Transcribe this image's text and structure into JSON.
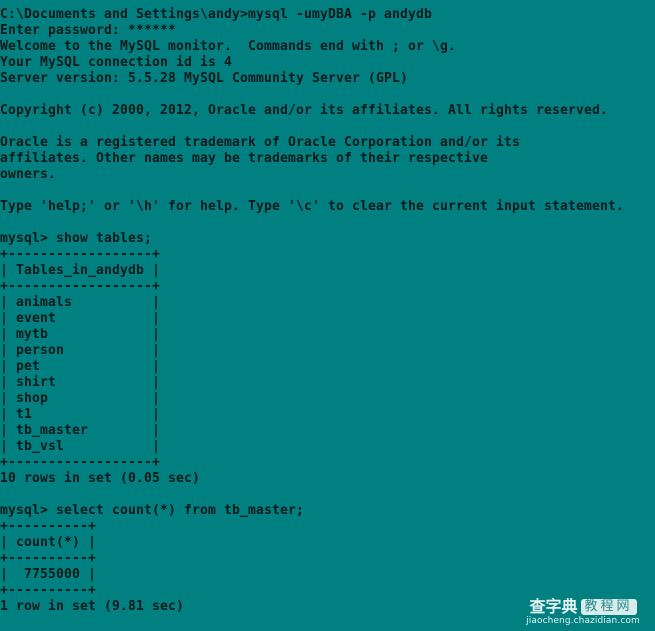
{
  "window": {
    "background_color": "#008080",
    "text_color": "#0c1a1a"
  },
  "console": {
    "lines": [
      "C:\\Documents and Settings\\andy>mysql -umyDBA -p andydb",
      "Enter password: ******",
      "Welcome to the MySQL monitor.  Commands end with ; or \\g.",
      "Your MySQL connection id is 4",
      "Server version: 5.5.28 MySQL Community Server (GPL)",
      "",
      "Copyright (c) 2000, 2012, Oracle and/or its affiliates. All rights reserved.",
      "",
      "Oracle is a registered trademark of Oracle Corporation and/or its",
      "affiliates. Other names may be trademarks of their respective",
      "owners.",
      "",
      "Type 'help;' or '\\h' for help. Type '\\c' to clear the current input statement.",
      "",
      "mysql> show tables;",
      "+------------------+",
      "| Tables_in_andydb |",
      "+------------------+",
      "| animals          |",
      "| event            |",
      "| mytb             |",
      "| person           |",
      "| pet              |",
      "| shirt            |",
      "| shop             |",
      "| t1               |",
      "| tb_master        |",
      "| tb_vsl           |",
      "+------------------+",
      "10 rows in set (0.05 sec)",
      "",
      "mysql> select count(*) from tb_master;",
      "+----------+",
      "| count(*) |",
      "+----------+",
      "|  7755000 |",
      "+----------+",
      "1 row in set (9.81 sec)"
    ]
  },
  "session": {
    "command": "mysql -umyDBA -p andydb",
    "prompt_path": "C:\\Documents and Settings\\andy>",
    "password_mask": "******",
    "connection_id": "4",
    "server_version": "5.5.28 MySQL Community Server (GPL)"
  },
  "queries": [
    {
      "statement": "show tables;",
      "column": "Tables_in_andydb",
      "rows": [
        "animals",
        "event",
        "mytb",
        "person",
        "pet",
        "shirt",
        "shop",
        "t1",
        "tb_master",
        "tb_vsl"
      ],
      "summary": "10 rows in set (0.05 sec)"
    },
    {
      "statement": "select count(*) from tb_master;",
      "column": "count(*)",
      "rows": [
        "7755000"
      ],
      "summary": "1 row in set (9.81 sec)"
    }
  ],
  "watermark": {
    "brand": "查字典",
    "badge": "教程网",
    "url": "jiaocheng.chazidian.com"
  }
}
